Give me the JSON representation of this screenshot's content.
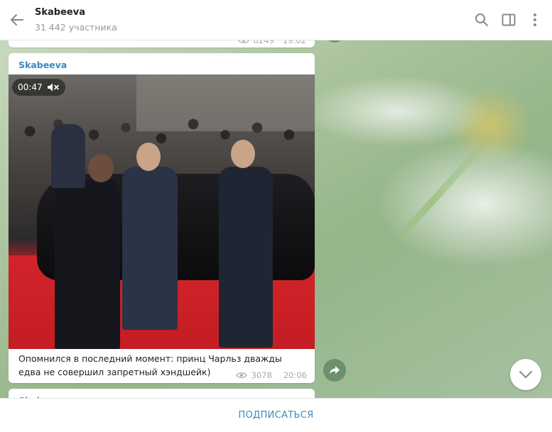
{
  "header": {
    "title": "Skabeeva",
    "subtitle": "31 442 участника"
  },
  "previous_message": {
    "views": "8249",
    "time": "19:02"
  },
  "message": {
    "author": "Skabeeva",
    "video_duration": "00:47",
    "caption": "Опомнился в последний момент: принц Чарльз дважды едва не совершил запретный хэндшейк)",
    "views": "3078",
    "time": "20:06"
  },
  "next_message": {
    "author": "Skabeeva"
  },
  "footer": {
    "subscribe_label": "ПОДПИСАТЬСЯ"
  },
  "icons": [
    "back-arrow-icon",
    "search-icon",
    "sidebar-toggle-icon",
    "more-vertical-icon",
    "muted-speaker-icon",
    "eye-icon",
    "share-icon",
    "chevron-down-icon"
  ],
  "colors": {
    "accent": "#3a8bbf",
    "meta": "#a0acb6"
  }
}
